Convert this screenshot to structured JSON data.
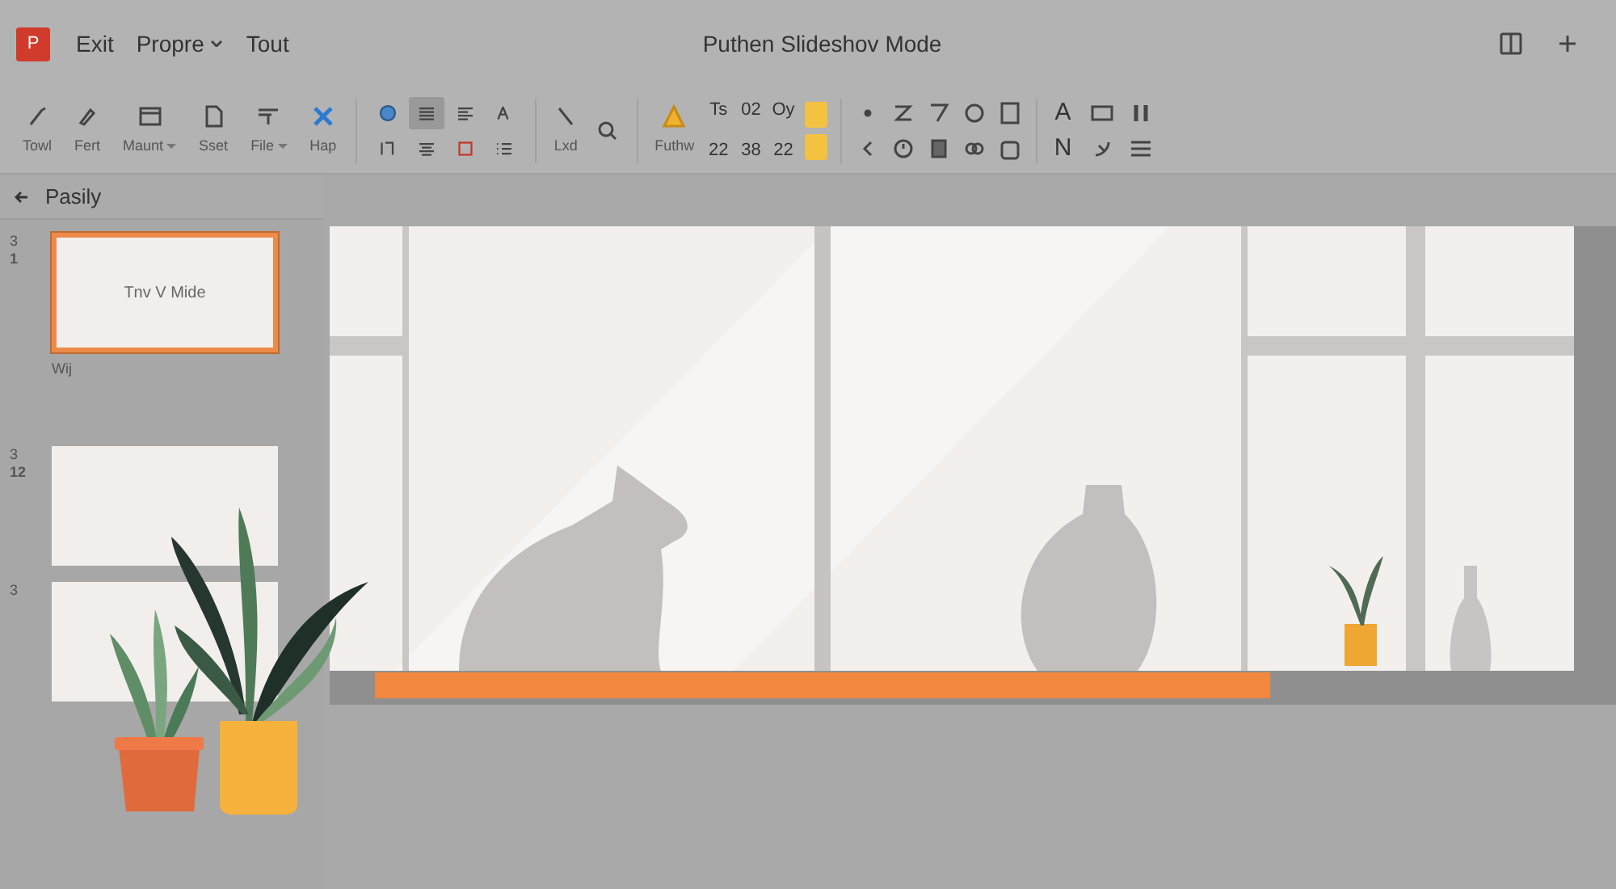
{
  "app": {
    "logo": "P",
    "menu": [
      {
        "label": "Exit",
        "dropdown": false
      },
      {
        "label": "Propre",
        "dropdown": true
      },
      {
        "label": "Tout",
        "dropdown": false
      }
    ],
    "title": "Puthen Slideshov Mode"
  },
  "toolbar": {
    "tools": [
      {
        "label": "Towl",
        "dropdown": false
      },
      {
        "label": "Fert",
        "dropdown": false
      },
      {
        "label": "Maunt",
        "dropdown": true
      },
      {
        "label": "Sset",
        "dropdown": false
      },
      {
        "label": "File",
        "dropdown": true
      },
      {
        "label": "Hap",
        "dropdown": false
      }
    ],
    "format_buttons": [
      {
        "selected": false
      },
      {
        "selected": true
      },
      {
        "selected": false
      },
      {
        "selected": false
      },
      {
        "selected": false
      },
      {
        "selected": false
      },
      {
        "selected": false
      },
      {
        "selected": false
      }
    ],
    "draw_label": "Lxd",
    "style_label": "Futhw",
    "sizes": [
      "Ts",
      "02",
      "Oy",
      "22",
      "38",
      "22"
    ],
    "letters": [
      "A",
      "N"
    ]
  },
  "slides_panel": {
    "title": "Pasily",
    "slides": [
      {
        "number": "3",
        "index": "1",
        "selected": true,
        "caption": "Tnv V Mide",
        "note": "Wij"
      },
      {
        "number": "3",
        "index": "12",
        "selected": false
      },
      {
        "number": "3",
        "selected": false
      }
    ]
  }
}
